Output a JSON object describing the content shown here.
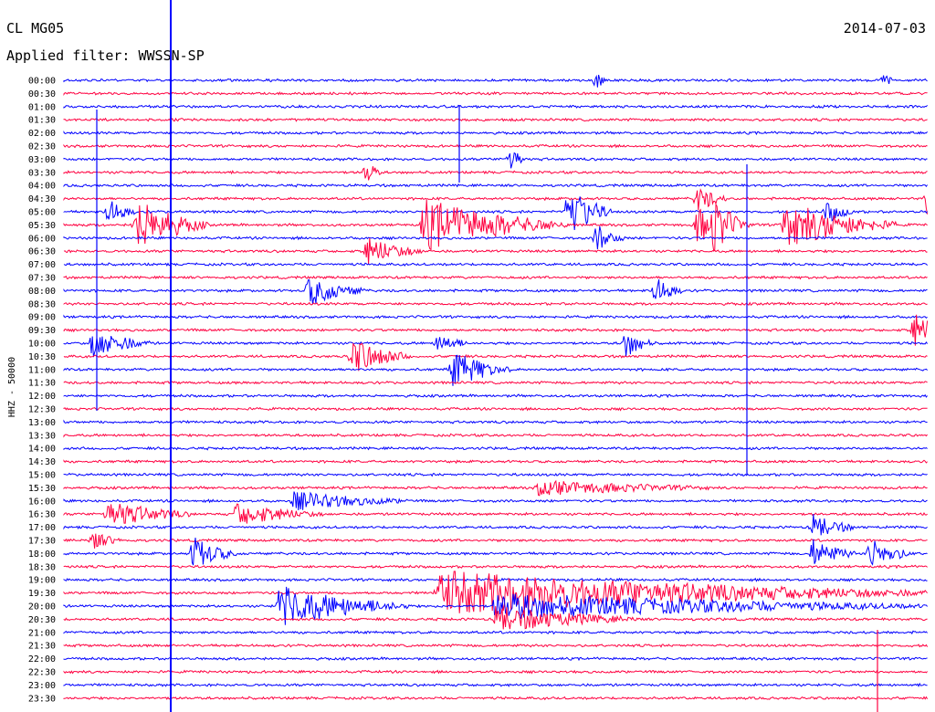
{
  "header": {
    "station": "CL MG05",
    "date": "2014-07-03",
    "filter": "Applied filter: WWSSN-SP"
  },
  "chart_data": {
    "type": "line",
    "title": "CL MG05",
    "ylabel": "HHZ - 50000",
    "rows": [
      "00:00",
      "00:30",
      "01:00",
      "01:30",
      "02:00",
      "02:30",
      "03:00",
      "03:30",
      "04:00",
      "04:30",
      "05:00",
      "05:30",
      "06:00",
      "06:30",
      "07:00",
      "07:30",
      "08:00",
      "08:30",
      "09:00",
      "09:30",
      "10:00",
      "10:30",
      "11:00",
      "11:30",
      "12:00",
      "12:30",
      "13:00",
      "13:30",
      "14:00",
      "14:30",
      "15:00",
      "15:30",
      "16:00",
      "16:30",
      "17:00",
      "17:30",
      "18:00",
      "18:30",
      "19:00",
      "19:30",
      "20:00",
      "20:30",
      "21:00",
      "21:30",
      "22:00",
      "22:30",
      "23:00",
      "23:30"
    ],
    "trace_colors": [
      "#0000ff",
      "#ff0040"
    ],
    "grid": false,
    "events": [
      {
        "row": 0,
        "minute": 18.5,
        "amp": 10,
        "dur": 0.3
      },
      {
        "row": 0,
        "minute": 28.5,
        "amp": 10,
        "dur": 0.3
      },
      {
        "row": 11,
        "minute": 2.5,
        "amp": 28,
        "dur": 2.5
      },
      {
        "row": 11,
        "minute": 12.5,
        "amp": 28,
        "dur": 5
      },
      {
        "row": 11,
        "minute": 25,
        "amp": 25,
        "dur": 4
      },
      {
        "row": 11,
        "minute": 22.5,
        "amp": 22,
        "dur": 1
      },
      {
        "row": 11,
        "minute": 22,
        "amp": 18,
        "dur": 2
      },
      {
        "row": 10,
        "minute": 26.5,
        "amp": 12,
        "dur": 1
      },
      {
        "row": 10,
        "minute": 1.5,
        "amp": 15,
        "dur": 1
      },
      {
        "row": 10,
        "minute": 17.5,
        "amp": 30,
        "dur": 1.5
      },
      {
        "row": 12,
        "minute": 18.5,
        "amp": 14,
        "dur": 1
      },
      {
        "row": 6,
        "minute": 15.5,
        "amp": 18,
        "dur": 0.5
      },
      {
        "row": 7,
        "minute": 10.5,
        "amp": 14,
        "dur": 0.5
      },
      {
        "row": 9,
        "minute": 22,
        "amp": 15,
        "dur": 1
      },
      {
        "row": 13,
        "minute": 10.5,
        "amp": 15,
        "dur": 2
      },
      {
        "row": 16,
        "minute": 8.5,
        "amp": 16,
        "dur": 2
      },
      {
        "row": 16,
        "minute": 20.5,
        "amp": 16,
        "dur": 1
      },
      {
        "row": 20,
        "minute": 1,
        "amp": 16,
        "dur": 2
      },
      {
        "row": 19,
        "minute": 29.5,
        "amp": 18,
        "dur": 1.5
      },
      {
        "row": 21,
        "minute": 10,
        "amp": 20,
        "dur": 2
      },
      {
        "row": 22,
        "minute": 13.5,
        "amp": 20,
        "dur": 2
      },
      {
        "row": 20,
        "minute": 13,
        "amp": 12,
        "dur": 1
      },
      {
        "row": 20,
        "minute": 19.5,
        "amp": 16,
        "dur": 1
      },
      {
        "row": 33,
        "minute": 1.5,
        "amp": 14,
        "dur": 3
      },
      {
        "row": 33,
        "minute": 6,
        "amp": 12,
        "dur": 3
      },
      {
        "row": 32,
        "minute": 8,
        "amp": 10,
        "dur": 4
      },
      {
        "row": 35,
        "minute": 1,
        "amp": 10,
        "dur": 1
      },
      {
        "row": 36,
        "minute": 4.5,
        "amp": 18,
        "dur": 1.5
      },
      {
        "row": 39,
        "minute": 13,
        "amp": 24,
        "dur": 17
      },
      {
        "row": 40,
        "minute": 7.5,
        "amp": 22,
        "dur": 4.5
      },
      {
        "row": 40,
        "minute": 15,
        "amp": 14,
        "dur": 15
      },
      {
        "row": 41,
        "minute": 15,
        "amp": 14,
        "dur": 5
      },
      {
        "row": 31,
        "minute": 16.5,
        "amp": 8,
        "dur": 6
      },
      {
        "row": 34,
        "minute": 26,
        "amp": 14,
        "dur": 1.5
      },
      {
        "row": 36,
        "minute": 26,
        "amp": 16,
        "dur": 1.5
      },
      {
        "row": 36,
        "minute": 28,
        "amp": 16,
        "dur": 1.5
      },
      {
        "row": 9,
        "minute": 30,
        "amp": 18,
        "dur": 2
      }
    ]
  }
}
